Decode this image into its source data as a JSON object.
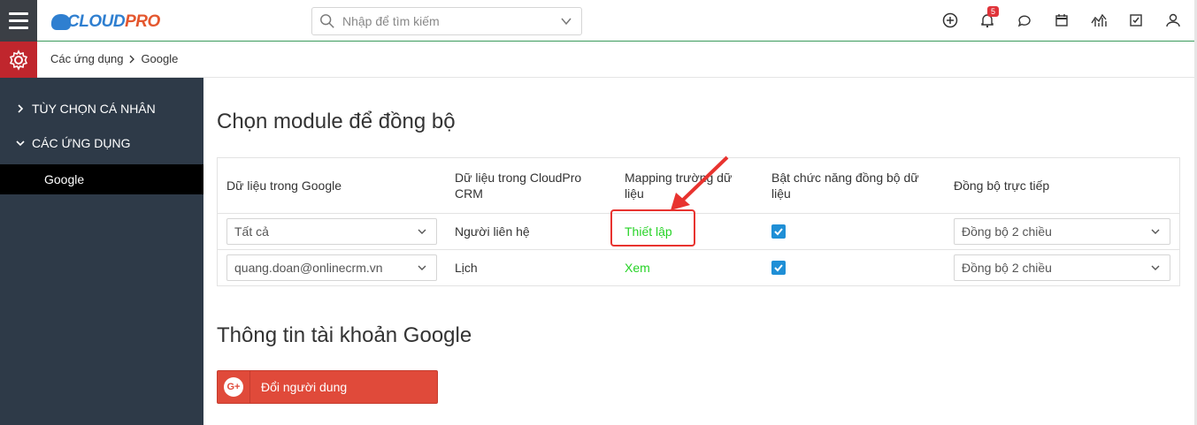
{
  "header": {
    "logo_prefix": "CLOUD",
    "logo_suffix": "PRO",
    "search_placeholder": "Nhập để tìm kiếm",
    "notification_count": "5"
  },
  "breadcrumb": {
    "parent": "Các ứng dụng",
    "current": "Google"
  },
  "sidebar": {
    "items": [
      {
        "label": "TÙY CHỌN CÁ NHÂN",
        "expanded": false
      },
      {
        "label": "CÁC ỨNG DỤNG",
        "expanded": true
      }
    ],
    "active_child": "Google"
  },
  "main": {
    "section1_title": "Chọn module để đồng bộ",
    "table": {
      "headers": [
        "Dữ liệu trong Google",
        "Dữ liệu trong CloudPro CRM",
        "Mapping trường dữ liệu",
        "Bật chức năng đồng bộ dữ liệu",
        "Đồng bộ trực tiếp"
      ],
      "rows": [
        {
          "google": "Tất cả",
          "crm": "Người liên hệ",
          "mapping": "Thiết lập",
          "enabled": true,
          "direction": "Đồng bộ 2 chiều"
        },
        {
          "google": "quang.doan@onlinecrm.vn",
          "crm": "Lịch",
          "mapping": "Xem",
          "enabled": true,
          "direction": "Đồng bộ 2 chiều"
        }
      ]
    },
    "section2_title": "Thông tin tài khoản Google",
    "change_user_button": "Đổi người dung",
    "google_icon_text": "G+"
  },
  "colors": {
    "sidebar_bg": "#2e3a48",
    "settings_red": "#c0262d",
    "link_green": "#27d327",
    "checkbox_blue": "#1f8fd6",
    "google_red": "#e04a3a",
    "annotation_red": "#e8332f"
  }
}
